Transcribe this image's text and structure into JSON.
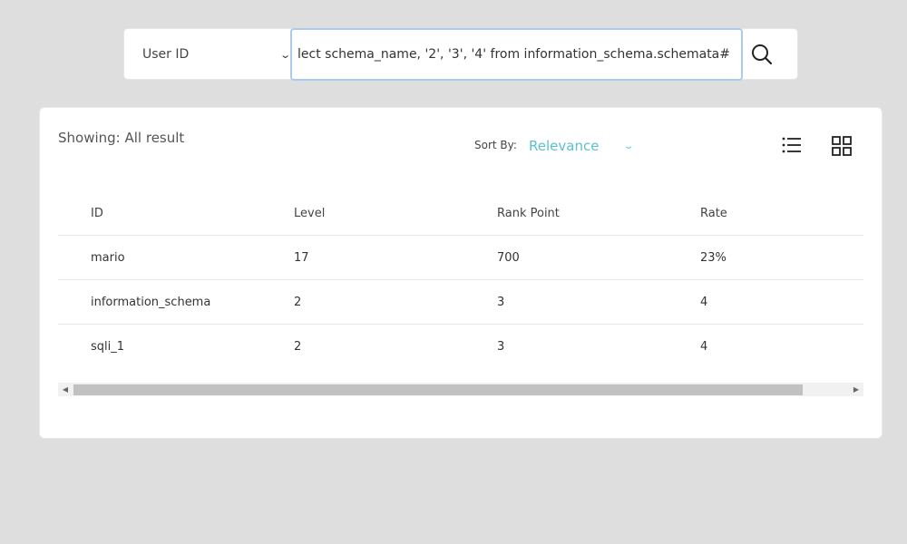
{
  "search": {
    "filter_selected": "User ID",
    "query_visible": "lect schema_name, '2', '3', '4' from information_schema.schemata#"
  },
  "icons": {
    "search": "search-icon",
    "list_view": "list-view-icon",
    "grid_view": "grid-view-icon",
    "chevron": "chevron-down-icon"
  },
  "results": {
    "showing_label": "Showing: All result",
    "sort_label": "Sort By:",
    "sort_selected": "Relevance",
    "columns": [
      "ID",
      "Level",
      "Rank Point",
      "Rate"
    ],
    "rows": [
      [
        "mario",
        "17",
        "700",
        "23%"
      ],
      [
        "information_schema",
        "2",
        "3",
        "4"
      ],
      [
        "sqli_1",
        "2",
        "3",
        "4"
      ]
    ]
  },
  "colors": {
    "accent": "#5bc0cf",
    "input_focus_border": "#a9cbef",
    "background": "#dedede"
  }
}
